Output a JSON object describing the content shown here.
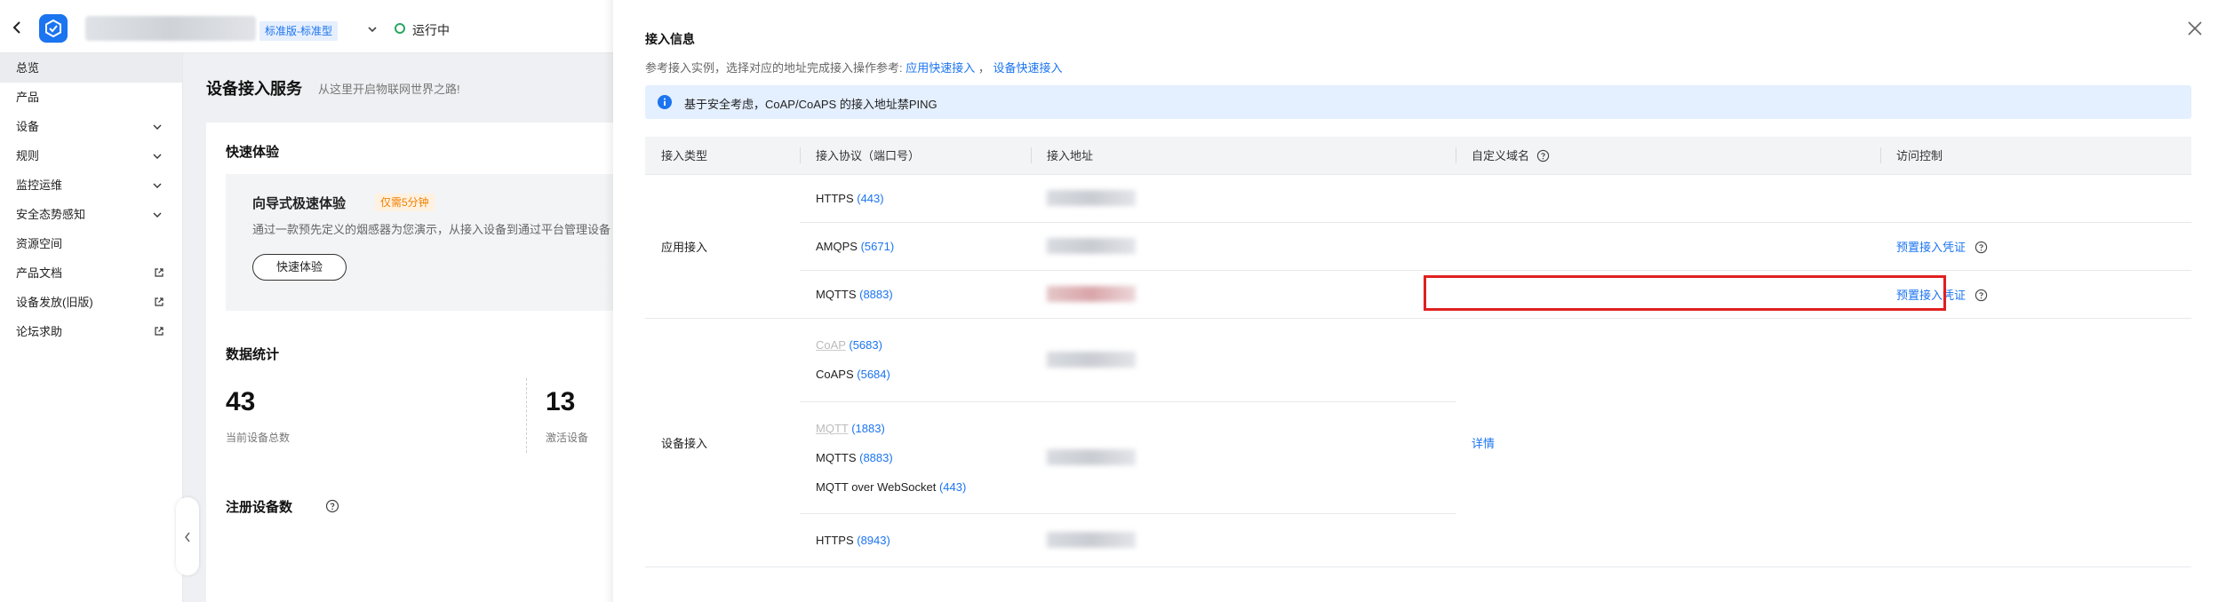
{
  "topbar": {
    "edition": "标准版-标准型",
    "status": "运行中"
  },
  "sidebar": {
    "items": [
      {
        "label": "总览"
      },
      {
        "label": "产品"
      },
      {
        "label": "设备"
      },
      {
        "label": "规则"
      },
      {
        "label": "监控运维"
      },
      {
        "label": "安全态势感知"
      },
      {
        "label": "资源空间"
      },
      {
        "label": "产品文档"
      },
      {
        "label": "设备发放(旧版)"
      },
      {
        "label": "论坛求助"
      }
    ]
  },
  "main": {
    "title": "设备接入服务",
    "subtitle": "从这里开启物联网世界之路!",
    "quick": {
      "title": "快速体验",
      "guide_title": "向导式极速体验",
      "guide_tag": "仅需5分钟",
      "guide_desc": "通过一款预先定义的烟感器为您演示，从接入设备到通过平台管理设备",
      "button": "快速体验"
    },
    "stats": {
      "title": "数据统计",
      "total_value": "43",
      "total_label": "当前设备总数",
      "active_value": "13",
      "active_label": "激活设备"
    },
    "registered": {
      "title": "注册设备数"
    }
  },
  "drawer": {
    "title": "接入信息",
    "desc_prefix": "参考接入实例，选择对应的地址完成接入操作参考:",
    "link_app": "应用快速接入",
    "separator": "，",
    "link_device": "设备快速接入",
    "notice": "基于安全考虑，CoAP/CoAPS 的接入地址禁PING",
    "columns": {
      "type": "接入类型",
      "protocol": "接入协议（端口号）",
      "address": "接入地址",
      "domain": "自定义域名",
      "access": "访问控制"
    },
    "app_group": {
      "type": "应用接入",
      "rows": [
        {
          "protocol": "HTTPS",
          "port": "(443)",
          "credential": ""
        },
        {
          "protocol": "AMQPS",
          "port": "(5671)",
          "credential": "预置接入凭证"
        },
        {
          "protocol": "MQTTS",
          "port": "(8883)",
          "credential": "预置接入凭证"
        }
      ]
    },
    "device_group": {
      "type": "设备接入",
      "detail": "详情",
      "coap": {
        "p1": "CoAP",
        "p1_port": "(5683)",
        "p2": "CoAPS",
        "p2_port": "(5684)"
      },
      "mqtt": {
        "p1": "MQTT",
        "p1_port": "(1883)",
        "p2": "MQTTS",
        "p2_port": "(8883)",
        "p3": "MQTT over WebSocket",
        "p3_port": "(443)"
      },
      "https": {
        "p1": "HTTPS",
        "p1_port": "(8943)"
      }
    }
  },
  "colors": {
    "accent": "#1b74f0",
    "notice_bg": "#e4efff",
    "highlight": "#e02020",
    "status_green": "#2aa760"
  }
}
